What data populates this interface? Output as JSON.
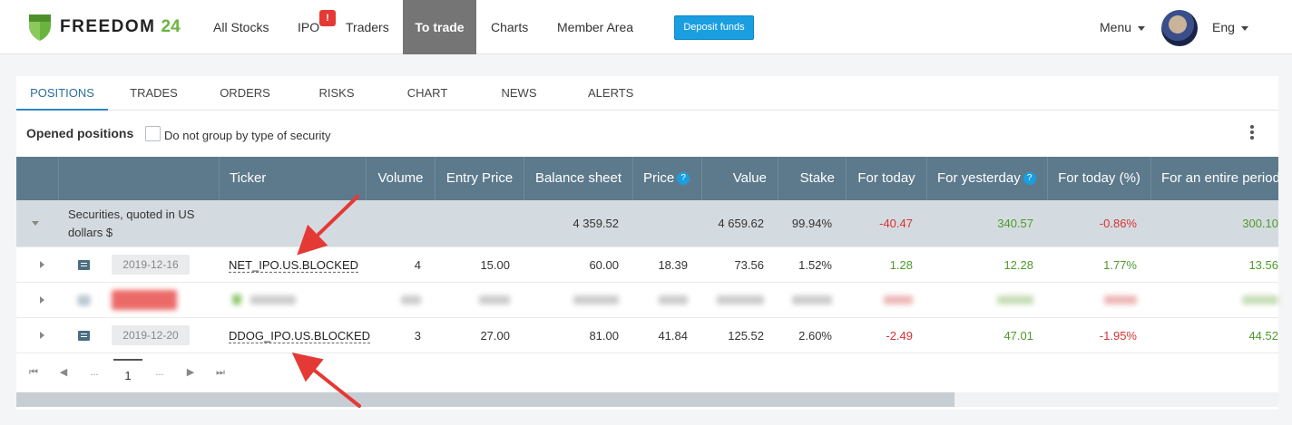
{
  "brand": {
    "name": "FREEDOM",
    "number": "24"
  },
  "nav": {
    "items": [
      "All Stocks",
      "IPO",
      "Traders",
      "To trade",
      "Charts",
      "Member Area"
    ],
    "ipo_badge": "!",
    "deposit_label": "Deposit funds",
    "menu_label": "Menu",
    "lang_label": "Eng"
  },
  "tabs": [
    "POSITIONS",
    "TRADES",
    "ORDERS",
    "RISKS",
    "CHART",
    "NEWS",
    "ALERTS"
  ],
  "positions": {
    "title": "Opened positions",
    "group_checkbox_label": "Do not group by type of security",
    "group_checked": false
  },
  "table": {
    "headers": [
      "Ticker",
      "Volume",
      "Entry Price",
      "Balance sheet",
      "Price",
      "Value",
      "Stake",
      "For today",
      "For yesterday",
      "For today (%)",
      "For an entire period"
    ],
    "group": {
      "label": "Securities, quoted in US dollars $",
      "balance": "4 359.52",
      "value": "4 659.62",
      "stake": "99.94%",
      "today": "-40.47",
      "yesterday": "340.57",
      "today_pct": "-0.86%",
      "period": "300.10"
    },
    "rows": [
      {
        "date": "2019-12-16",
        "ticker": "NET_IPO.US.BLOCKED",
        "volume": "4",
        "entry": "15.00",
        "balance": "60.00",
        "price": "18.39",
        "value": "73.56",
        "stake": "1.52%",
        "today": "1.28",
        "yesterday": "12.28",
        "today_pct": "1.77%",
        "period": "13.56"
      },
      {
        "date": "",
        "ticker": "",
        "volume": "",
        "entry": "",
        "balance": "",
        "price": "",
        "value": "",
        "stake": "",
        "today": "",
        "yesterday": "",
        "today_pct": "",
        "period": "",
        "redacted": true
      },
      {
        "date": "2019-12-20",
        "ticker": "DDOG_IPO.US.BLOCKED",
        "volume": "3",
        "entry": "27.00",
        "balance": "81.00",
        "price": "41.84",
        "value": "125.52",
        "stake": "2.60%",
        "today": "-2.49",
        "yesterday": "47.01",
        "today_pct": "-1.95%",
        "period": "44.52"
      }
    ]
  },
  "pager": {
    "first": "⏮",
    "prev": "◀",
    "ellipsis": "...",
    "current": "1",
    "next": "▶",
    "last": "⏭"
  },
  "colors": {
    "accent": "#1a9ee0",
    "header": "#5d7a8c",
    "positive": "#4f9a2a",
    "negative": "#d83232",
    "annotation": "#e53935"
  }
}
